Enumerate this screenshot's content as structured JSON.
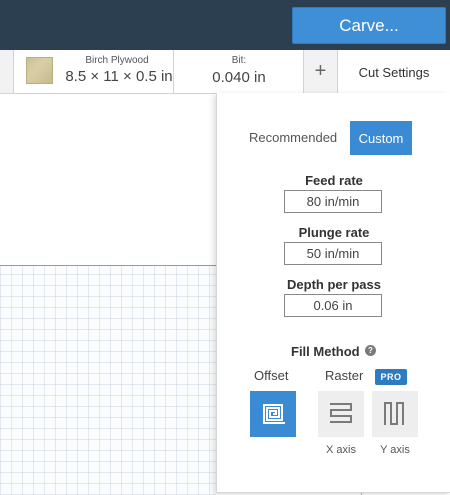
{
  "topbar": {
    "carve_label": "Carve..."
  },
  "toolbar": {
    "material_name": "Birch Plywood",
    "material_dims": "8.5 × 11 × 0.5 in",
    "bit_label": "Bit:",
    "bit_value": "0.040 in",
    "plus_label": "+",
    "cut_settings_label": "Cut Settings"
  },
  "panel": {
    "mode_recommended": "Recommended",
    "mode_custom": "Custom",
    "feed_rate_label": "Feed rate",
    "feed_rate_value": "80 in/min",
    "plunge_rate_label": "Plunge rate",
    "plunge_rate_value": "50 in/min",
    "depth_label": "Depth per pass",
    "depth_value": "0.06 in",
    "fill_method_label": "Fill Method",
    "help_glyph": "?",
    "offset_label": "Offset",
    "raster_label": "Raster",
    "pro_badge": "PRO",
    "x_axis_label": "X axis",
    "y_axis_label": "Y axis"
  },
  "colors": {
    "topbar": "#2c3f51",
    "accent": "#3b8bd4",
    "tile_inactive": "#eeeeee"
  }
}
